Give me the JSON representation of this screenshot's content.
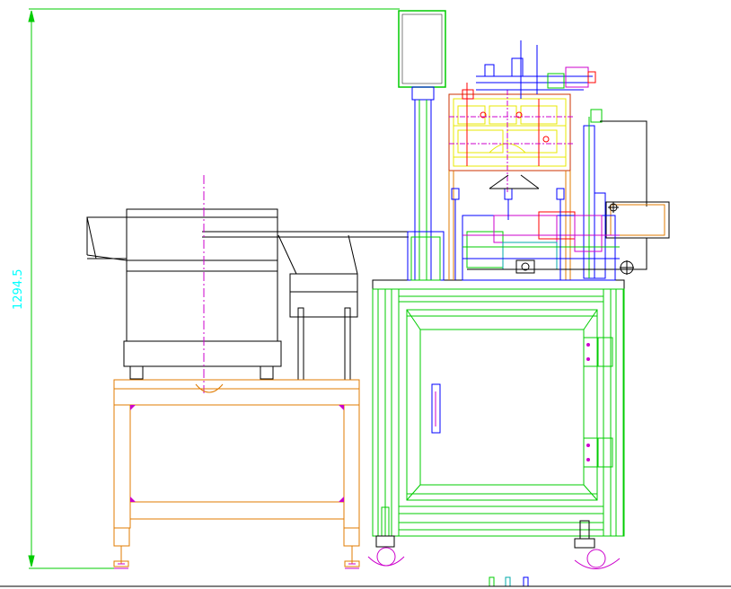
{
  "drawing": {
    "dimension_label": "1294.5",
    "colors": {
      "background": "#ffffff",
      "outline": "#000000",
      "dimension": "#00ffff",
      "frame_green": "#00cc00",
      "table_orange": "#e07b00",
      "center_magenta": "#cc00cc",
      "blue": "#0000ff",
      "yellow": "#e8e800",
      "red": "#ff0000"
    }
  }
}
